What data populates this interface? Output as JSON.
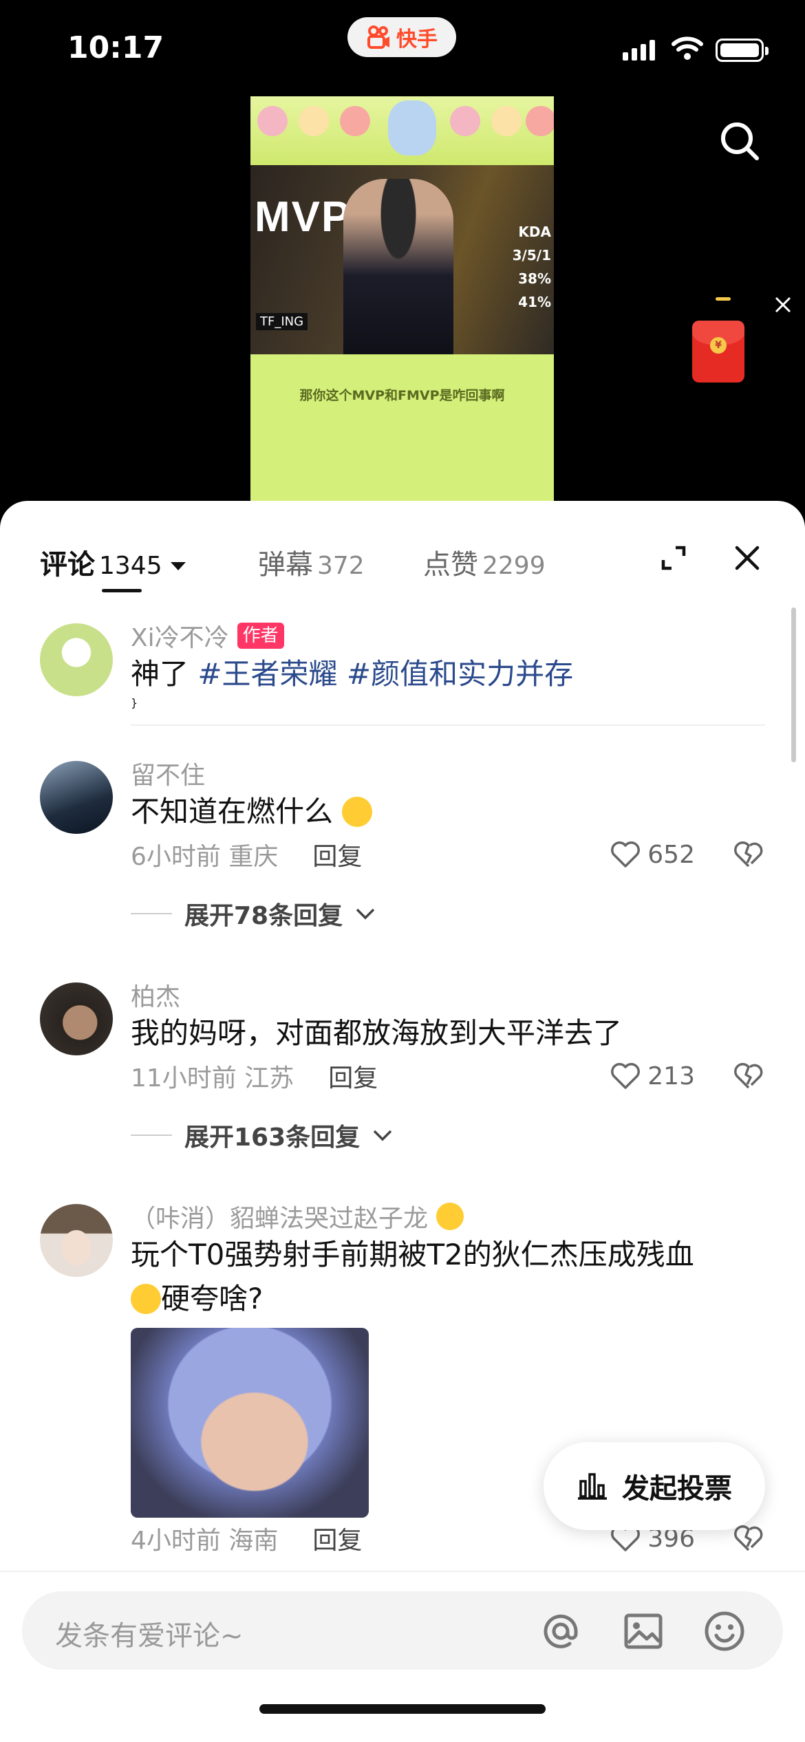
{
  "status_bar": {
    "time": "10:17",
    "app_name": "快手"
  },
  "video": {
    "mvp_text": "MVP",
    "team_tag": "TF_ING",
    "stats": [
      "KDA",
      "3/5/1",
      "38%",
      "41%"
    ],
    "subtitle": "那你这个MVP和FMVP是咋回事啊"
  },
  "tabs": [
    {
      "label": "评论",
      "count": "1345"
    },
    {
      "label": "弹幕",
      "count": "372"
    },
    {
      "label": "点赞",
      "count": "2299"
    }
  ],
  "comments": [
    {
      "user": "Xi冷不冷",
      "badge": "作者",
      "text_prefix": "神了 ",
      "hashtags": [
        "#王者荣耀",
        "#颜值和实力并存"
      ]
    },
    {
      "user": "留不住",
      "text": "不知道在燃什么",
      "time": "6小时前",
      "location": "重庆",
      "reply": "回复",
      "likes": "652",
      "expand": "展开78条回复"
    },
    {
      "user": "柏杰",
      "text": "我的妈呀，对面都放海放到大平洋去了",
      "time": "11小时前",
      "location": "江苏",
      "reply": "回复",
      "likes": "213",
      "expand": "展开163条回复"
    },
    {
      "user": "（咔消）貂蝉法哭过赵子龙",
      "text_line1": "玩个T0强势射手前期被T2的狄仁杰压成残血",
      "text_line2": "硬夸啥?",
      "time": "4小时前",
      "location": "海南",
      "reply": "回复",
      "likes": "396"
    }
  ],
  "vote_button": "发起投票",
  "input": {
    "placeholder": "发条有爱评论~"
  },
  "colors": {
    "accent_red": "#fe3666",
    "hashtag": "#2b4a8c",
    "kuaishou_orange": "#ff4b2b"
  }
}
